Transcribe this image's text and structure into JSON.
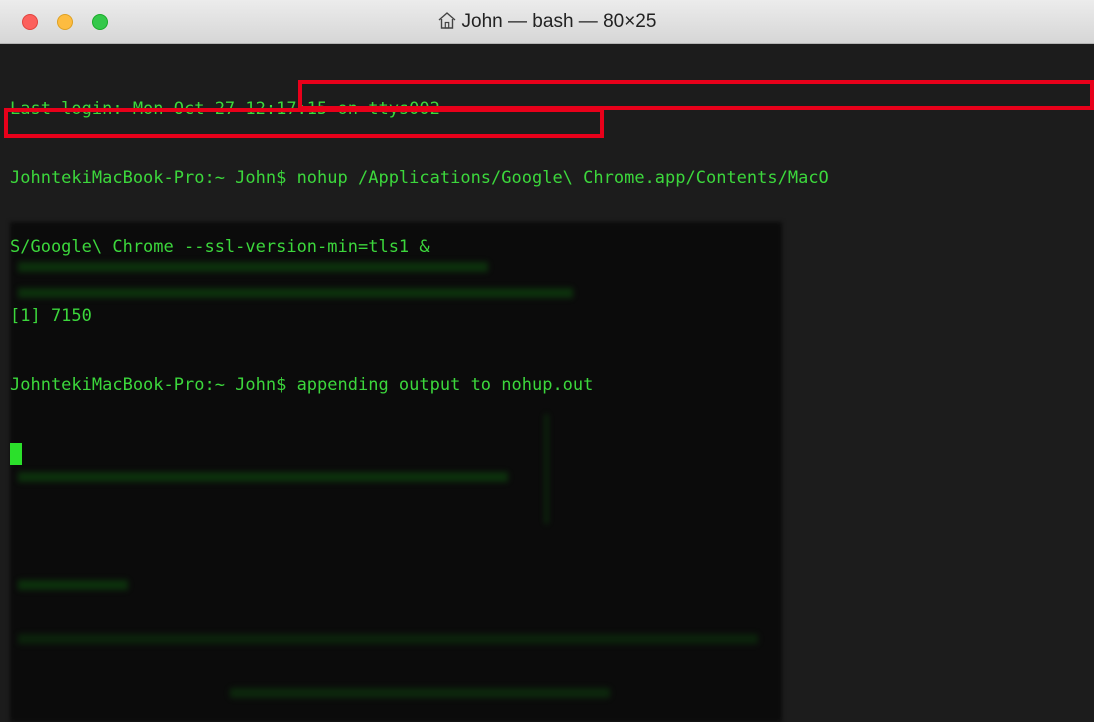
{
  "window": {
    "title": "John — bash — 80×25",
    "title_icon": "home-icon"
  },
  "terminal": {
    "lines": [
      "Last login: Mon Oct 27 12:17:15 on ttys002",
      "JohntekiMacBook-Pro:~ John$ nohup /Applications/Google\\ Chrome.app/Contents/MacO",
      "S/Google\\ Chrome --ssl-version-min=tls1 &",
      "[1] 7150",
      "JohntekiMacBook-Pro:~ John$ appending output to nohup.out"
    ],
    "text_color": "#3cd73c",
    "background_color": "#1c1c1c",
    "highlight_color": "#e8001a"
  }
}
